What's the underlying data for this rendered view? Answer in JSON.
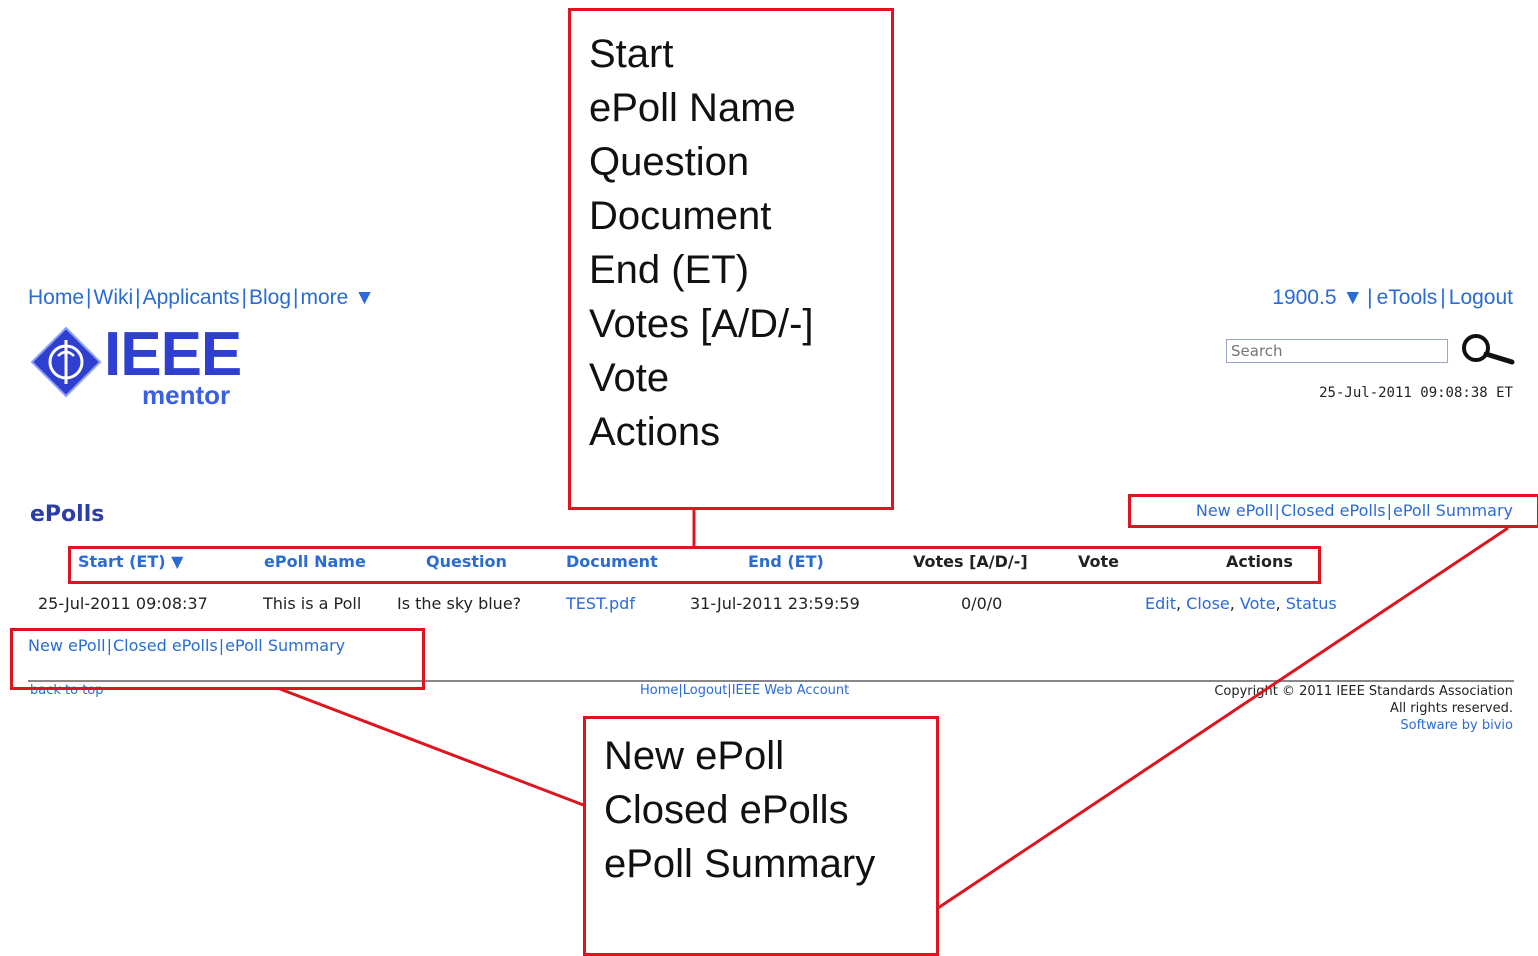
{
  "nav": {
    "home": "Home",
    "wiki": "Wiki",
    "applicants": "Applicants",
    "blog": "Blog",
    "more": "more ▼",
    "sep": "|"
  },
  "header_right": {
    "group": "1900.5 ▼",
    "etools": "eTools",
    "logout": "Logout"
  },
  "logo": {
    "main": "IEEE",
    "sub": "mentor"
  },
  "search": {
    "placeholder": "Search"
  },
  "datetime": "25-Jul-2011 09:08:38 ET",
  "page_title": "ePolls",
  "action_links": {
    "new_epoll": "New ePoll",
    "closed_epolls": "Closed ePolls",
    "epoll_summary": "ePoll Summary"
  },
  "table": {
    "headers": [
      "Start (ET) ▼",
      "ePoll Name",
      "Question",
      "Document",
      "End (ET)",
      "Votes [A/D/-]",
      "Vote",
      "Actions"
    ],
    "rows": [
      {
        "start": "25-Jul-2011 09:08:37",
        "name": "This is a Poll",
        "question": "Is the sky blue?",
        "document": "TEST.pdf",
        "end": "31-Jul-2011 23:59:59",
        "votes": "0/0/0",
        "vote": "",
        "actions": [
          "Edit",
          "Close",
          "Vote",
          "Status"
        ]
      }
    ]
  },
  "footer": {
    "back_to_top": "back to top",
    "home": "Home",
    "logout": "Logout",
    "web_account": "IEEE Web Account",
    "copyright": "Copyright © 2011 IEEE Standards Association",
    "rights": "All rights reserved.",
    "software": "Software by bivio"
  },
  "annotations": {
    "columns": [
      "Start",
      "ePoll Name",
      "Question",
      "Document",
      "End (ET)",
      "Votes [A/D/-]",
      "Vote",
      "Actions"
    ],
    "links": [
      "New ePoll",
      "Closed ePolls",
      "ePoll Summary"
    ]
  },
  "colors": {
    "link": "#2a6bd6",
    "annotation": "#e0141e",
    "title": "#2d3da8"
  }
}
